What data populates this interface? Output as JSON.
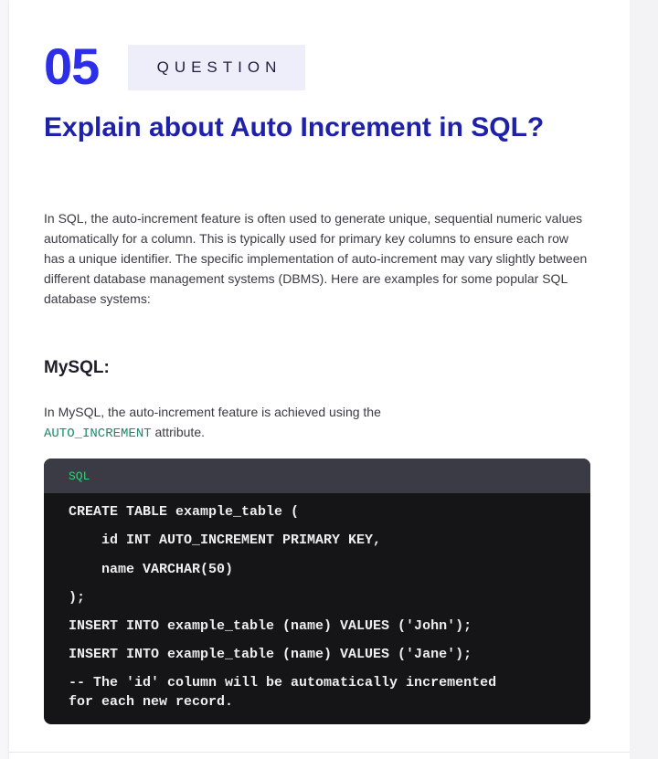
{
  "question": {
    "number": "05",
    "tag": "QUESTION"
  },
  "title": "Explain about Auto Increment in SQL?",
  "intro": "In SQL, the auto-increment feature is often used to generate unique, sequential numeric values automatically for a column. This is typically used for primary key columns to ensure each row has a unique identifier. The specific implementation of auto-increment may vary slightly between different database management systems (DBMS). Here are examples for some popular SQL database systems:",
  "section": {
    "heading": "MySQL:",
    "para_before": "In MySQL, the auto-increment feature is achieved using the ",
    "keyword": "AUTO_INCREMENT",
    "para_after": " attribute."
  },
  "code": {
    "language": "SQL",
    "lines": [
      "CREATE TABLE example_table (",
      "    id INT AUTO_INCREMENT PRIMARY KEY,",
      "    name VARCHAR(50)",
      ");",
      "INSERT INTO example_table (name) VALUES ('John');",
      "INSERT INTO example_table (name) VALUES ('Jane');",
      "-- The 'id' column will be automatically incremented",
      "for each new record."
    ]
  },
  "colors": {
    "accent": "#2c2ee8",
    "title": "#1e22a8",
    "code_bg": "#151517",
    "code_header": "#3a3b44",
    "code_lang": "#33d17a",
    "inline_code": "#1a8a6a"
  }
}
